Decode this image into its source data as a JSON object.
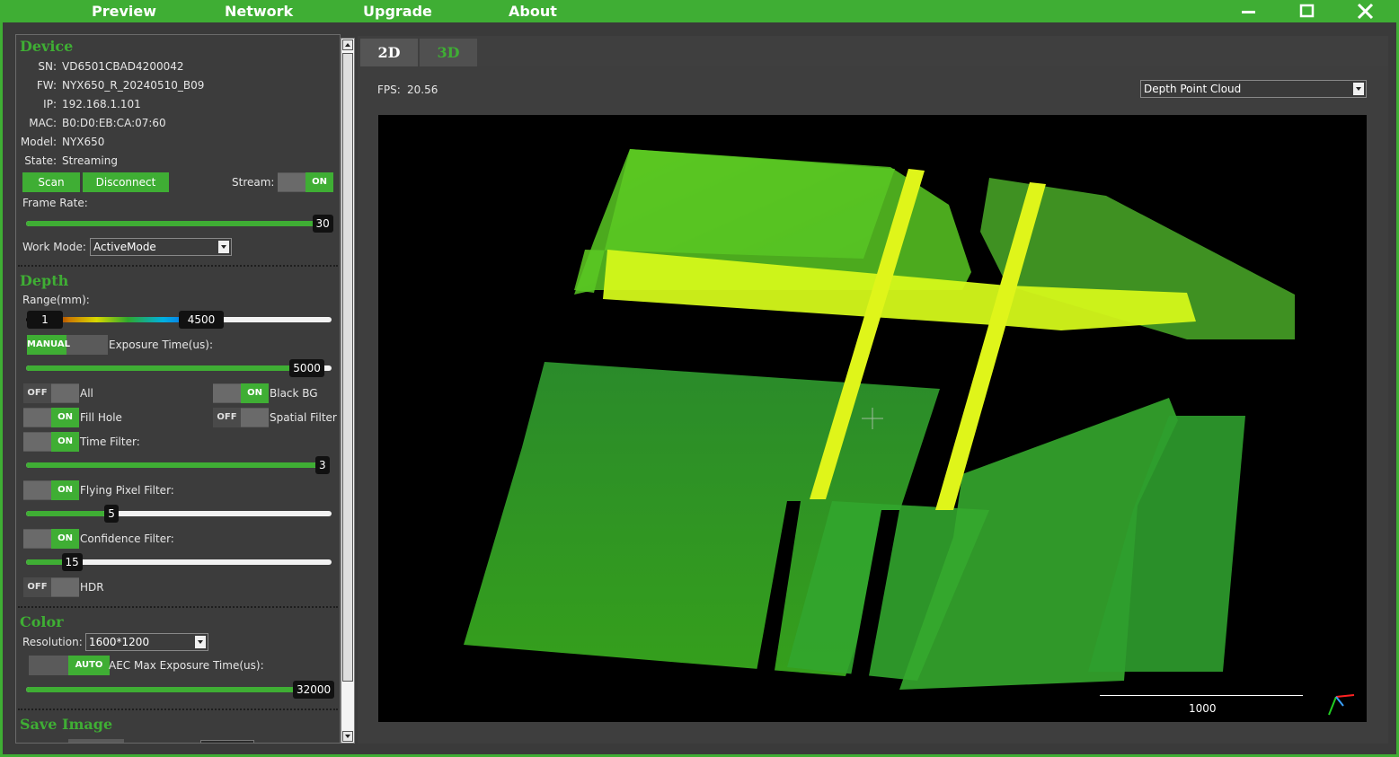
{
  "menu": {
    "items": [
      "Preview",
      "Network",
      "Upgrade",
      "About"
    ],
    "window_controls": [
      "minimize-icon",
      "maximize-icon",
      "close-icon"
    ]
  },
  "colors": {
    "accent": "#3fae34",
    "background": "#3a3a3a",
    "viewport": "#000000"
  },
  "device": {
    "title": "Device",
    "sn_label": "SN:",
    "sn": "VD6501CBAD4200042",
    "fw_label": "FW:",
    "fw": "NYX650_R_20240510_B09",
    "ip_label": "IP:",
    "ip": "192.168.1.101",
    "mac_label": "MAC:",
    "mac": "B0:D0:EB:CA:07:60",
    "model_label": "Model:",
    "model": "NYX650",
    "state_label": "State:",
    "state": "Streaming",
    "scan_button": "Scan",
    "disconnect_button": "Disconnect",
    "stream_label": "Stream:",
    "stream_toggle": "ON",
    "frame_rate_label": "Frame Rate:",
    "frame_rate": "30",
    "frame_rate_fraction": 1.0,
    "work_mode_label": "Work Mode:",
    "work_mode": "ActiveMode"
  },
  "depth": {
    "title": "Depth",
    "range_label": "Range(mm):",
    "range_min": "1",
    "range_max": "4500",
    "exposure_mode": "MANUAL",
    "exposure_label": "Exposure Time(us):",
    "exposure": "5000",
    "exposure_fraction": 0.92,
    "all_toggle": "OFF",
    "all_label": "All",
    "black_bg_toggle": "ON",
    "black_bg_label": "Black BG",
    "fill_hole_toggle": "ON",
    "fill_hole_label": "Fill Hole",
    "spatial_filter_toggle": "OFF",
    "spatial_filter_label": "Spatial Filter",
    "time_filter_toggle": "ON",
    "time_filter_label": "Time Filter:",
    "time_filter": "3",
    "time_filter_fraction": 1.0,
    "flying_pixel_toggle": "ON",
    "flying_pixel_label": "Flying Pixel Filter:",
    "flying_pixel": "5",
    "flying_pixel_fraction": 0.28,
    "confidence_toggle": "ON",
    "confidence_label": "Confidence Filter:",
    "confidence": "15",
    "confidence_fraction": 0.15,
    "hdr_toggle": "OFF",
    "hdr_label": "HDR"
  },
  "color": {
    "title": "Color",
    "resolution_label": "Resolution:",
    "resolution": "1600*1200",
    "aec_mode": "AUTO",
    "aec_label": "AEC Max Exposure Time(us):",
    "aec": "32000",
    "aec_fraction": 1.0
  },
  "save_image": {
    "title": "Save Image"
  },
  "view": {
    "tabs": [
      "2D",
      "3D"
    ],
    "active_tab": "2D",
    "fps_label": "FPS:",
    "fps": "20.56",
    "display_mode": "Depth Point Cloud",
    "scale_label": "1000"
  }
}
